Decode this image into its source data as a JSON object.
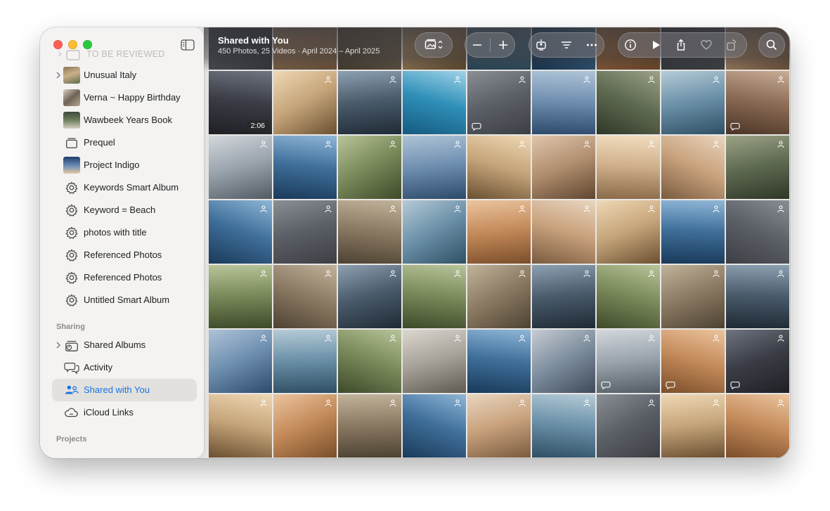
{
  "header": {
    "title": "Shared with You",
    "subtitle": "450 Photos, 25 Videos · April 2024 – April 2025"
  },
  "sidebar": {
    "faded_label": "TO BE REVIEWED",
    "items": [
      {
        "label": "Unusual Italy"
      },
      {
        "label": "Verna ~ Happy Birthday"
      },
      {
        "label": "Wawbeek Years Book"
      },
      {
        "label": "Prequel"
      },
      {
        "label": "Project Indigo"
      },
      {
        "label": "Keywords Smart Album"
      },
      {
        "label": "Keyword = Beach"
      },
      {
        "label": "photos with title"
      },
      {
        "label": "Referenced Photos"
      },
      {
        "label": "Referenced Photos"
      },
      {
        "label": "Untitled Smart Album"
      }
    ],
    "sharing_heading": "Sharing",
    "sharing_items": [
      {
        "label": "Shared Albums"
      },
      {
        "label": "Activity"
      },
      {
        "label": "Shared with You",
        "selected": true
      },
      {
        "label": "iCloud Links"
      }
    ],
    "projects_heading": "Projects"
  },
  "grid": {
    "video_duration": "2:06"
  },
  "colors": {
    "accent": "#1673e6",
    "sidebar_bg": "#f4f3f2",
    "selected_bg": "#e3e1de"
  }
}
